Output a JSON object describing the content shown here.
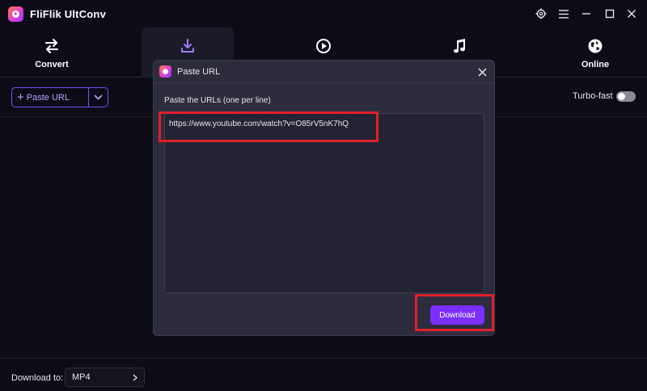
{
  "app": {
    "title": "FliFlik UltConv"
  },
  "nav": {
    "tabs": [
      {
        "label": "Convert",
        "icon": "convert-arrows-icon"
      },
      {
        "label": "",
        "icon": "download-icon"
      },
      {
        "label": "",
        "icon": "play-circle-icon"
      },
      {
        "label": "",
        "icon": "music-note-icon"
      },
      {
        "label": "Online",
        "icon": "globe-icon"
      }
    ]
  },
  "toolbar": {
    "paste_url_label": "Paste URL",
    "turbo_label": "Turbo-fast",
    "turbo_on": false
  },
  "bottom": {
    "download_to_label": "Download to:",
    "format_value": "MP4"
  },
  "dialog": {
    "title": "Paste URL",
    "instruction": "Paste the URLs (one per line)",
    "url_value": "https://www.youtube.com/watch?v=O85rV5nK7hQ",
    "download_label": "Download"
  },
  "colors": {
    "accent": "#7b2fff",
    "highlight": "#e0202a",
    "background": "#0c0c17",
    "dialog_bg": "#2c2c3d"
  }
}
